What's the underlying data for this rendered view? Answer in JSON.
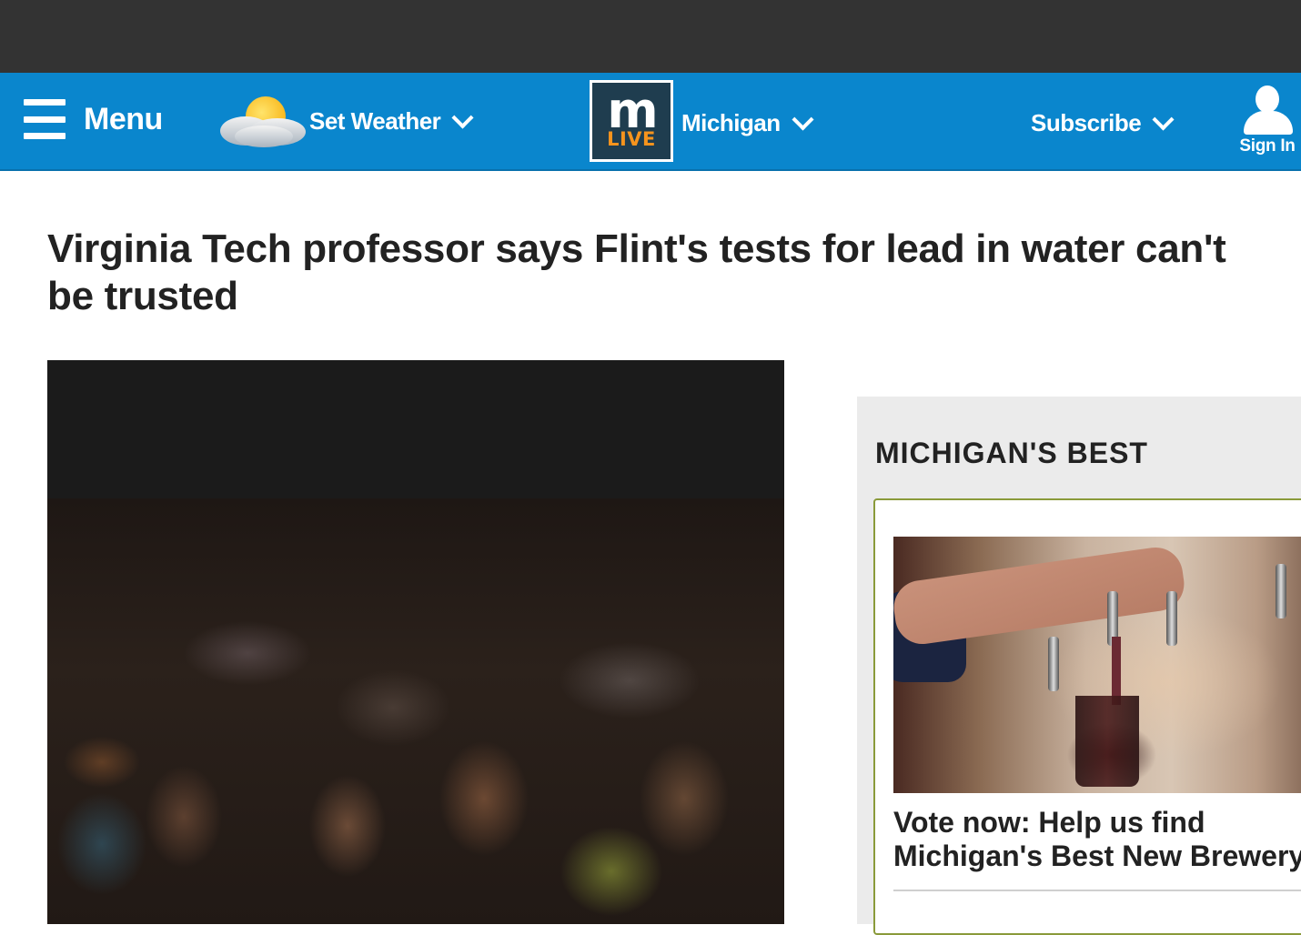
{
  "nav": {
    "menu_label": "Menu",
    "weather_label": "Set Weather",
    "logo_top": "m",
    "logo_bottom": "LIVE",
    "region_label": "Michigan",
    "subscribe_label": "Subscribe",
    "signin_label": "Sign In"
  },
  "article": {
    "headline": "Virginia Tech professor says Flint's tests for lead in water can't be trusted"
  },
  "sidebar": {
    "title": "MICHIGAN'S BEST",
    "card_text": "Vote now: Help us find Michigan's Best New Brewery"
  },
  "colors": {
    "nav_background": "#0a86cd",
    "top_bar": "#333333",
    "logo_accent": "#f7941d"
  }
}
